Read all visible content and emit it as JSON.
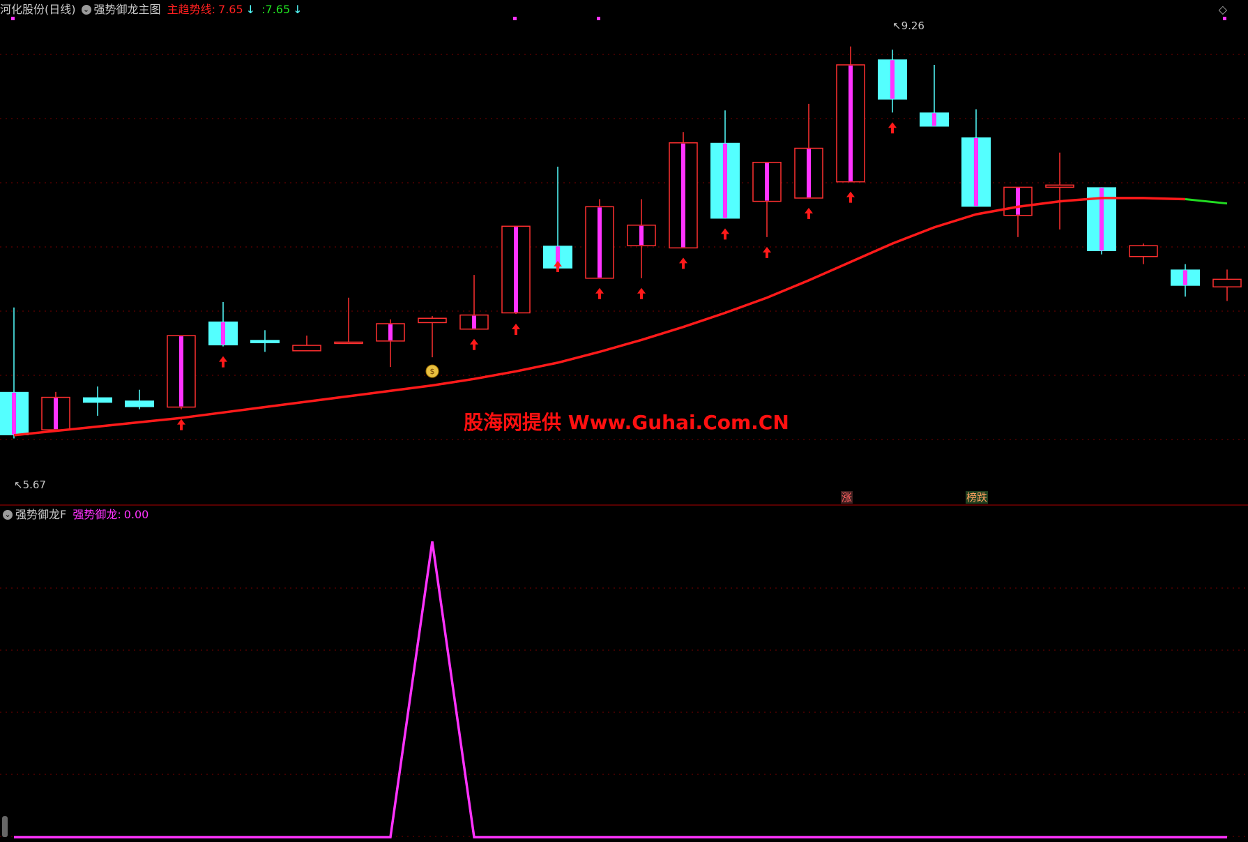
{
  "main_panel": {
    "stock_name": "河化股份(日线)",
    "indicator_name": "强势御龙主图",
    "trend_label": "主趋势线:",
    "trend_value_red": "7.65",
    "trend_value_green": ":7.65",
    "down_arrow": "↓",
    "high_label": "9.26",
    "low_label": "5.67",
    "tag_zhang": "涨",
    "tag_bangdie": "榜跌",
    "watermark": "股海网提供 Www.Guhai.Com.CN"
  },
  "sub_panel": {
    "indicator_name": "强势御龙F",
    "series_label": "强势御龙:",
    "series_value": "0.00"
  },
  "colors": {
    "up": "#ff3030",
    "down": "#54ffff",
    "trend": "#ff1a1a",
    "trend_tail": "#22dd22",
    "magenta": "#ff33ff",
    "grid": "#7a0000"
  },
  "icons": [
    "chevron-down-icon",
    "diamond-icon",
    "up-arrow-icon",
    "money-bag-icon"
  ],
  "chart_data": [
    {
      "type": "candlestick",
      "title": "强势御龙主图",
      "ylim": [
        5.3,
        9.5
      ],
      "candles": [
        {
          "o": 6.1,
          "h": 6.88,
          "l": 5.67,
          "c": 5.7
        },
        {
          "o": 5.75,
          "h": 6.1,
          "l": 5.75,
          "c": 6.05
        },
        {
          "o": 6.05,
          "h": 6.15,
          "l": 5.88,
          "c": 6.0
        },
        {
          "o": 6.02,
          "h": 6.12,
          "l": 5.94,
          "c": 5.96
        },
        {
          "o": 5.96,
          "h": 6.62,
          "l": 5.94,
          "c": 6.62
        },
        {
          "o": 6.75,
          "h": 6.93,
          "l": 6.52,
          "c": 6.53
        },
        {
          "o": 6.58,
          "h": 6.67,
          "l": 6.47,
          "c": 6.55
        },
        {
          "o": 6.48,
          "h": 6.62,
          "l": 6.48,
          "c": 6.53
        },
        {
          "o": 6.55,
          "h": 6.97,
          "l": 6.55,
          "c": 6.56
        },
        {
          "o": 6.57,
          "h": 6.77,
          "l": 6.33,
          "c": 6.73
        },
        {
          "o": 6.74,
          "h": 6.8,
          "l": 6.42,
          "c": 6.78
        },
        {
          "o": 6.68,
          "h": 7.18,
          "l": 6.68,
          "c": 6.81
        },
        {
          "o": 6.83,
          "h": 7.63,
          "l": 6.82,
          "c": 7.63
        },
        {
          "o": 7.45,
          "h": 8.18,
          "l": 7.4,
          "c": 7.24
        },
        {
          "o": 7.15,
          "h": 7.88,
          "l": 7.15,
          "c": 7.81
        },
        {
          "o": 7.45,
          "h": 7.88,
          "l": 7.15,
          "c": 7.64
        },
        {
          "o": 7.43,
          "h": 8.5,
          "l": 7.43,
          "c": 8.4
        },
        {
          "o": 8.4,
          "h": 8.7,
          "l": 7.7,
          "c": 7.7
        },
        {
          "o": 7.86,
          "h": 8.03,
          "l": 7.53,
          "c": 8.22
        },
        {
          "o": 7.89,
          "h": 8.76,
          "l": 7.89,
          "c": 8.35
        },
        {
          "o": 8.04,
          "h": 9.29,
          "l": 8.04,
          "c": 9.12
        },
        {
          "o": 9.17,
          "h": 9.26,
          "l": 8.68,
          "c": 8.8
        },
        {
          "o": 8.68,
          "h": 9.12,
          "l": 8.61,
          "c": 8.55
        },
        {
          "o": 8.45,
          "h": 8.71,
          "l": 7.84,
          "c": 7.81
        },
        {
          "o": 7.73,
          "h": 7.92,
          "l": 7.53,
          "c": 7.99
        },
        {
          "o": 7.99,
          "h": 8.31,
          "l": 7.6,
          "c": 8.01
        },
        {
          "o": 7.99,
          "h": 7.99,
          "l": 7.37,
          "c": 7.4
        },
        {
          "o": 7.35,
          "h": 7.47,
          "l": 7.28,
          "c": 7.45
        },
        {
          "o": 7.23,
          "h": 7.28,
          "l": 6.98,
          "c": 7.08
        },
        {
          "o": 7.07,
          "h": 7.23,
          "l": 6.94,
          "c": 7.14
        }
      ],
      "trend_line": [
        5.7,
        5.74,
        5.78,
        5.82,
        5.86,
        5.91,
        5.96,
        6.01,
        6.06,
        6.11,
        6.16,
        6.22,
        6.29,
        6.37,
        6.47,
        6.58,
        6.7,
        6.83,
        6.97,
        7.13,
        7.3,
        7.47,
        7.62,
        7.74,
        7.81,
        7.86,
        7.89,
        7.89,
        7.88,
        7.84
      ],
      "trend_green_from_index": 28,
      "arrows_under_index": [
        4,
        5,
        11,
        12,
        13,
        14,
        15,
        16,
        17,
        18,
        19,
        20,
        21
      ],
      "money_bag_index": 10,
      "high": 9.26,
      "low": 5.67
    },
    {
      "type": "line",
      "title": "强势御龙F",
      "series": [
        {
          "name": "强势御龙",
          "values": [
            0,
            0,
            0,
            0,
            0,
            0,
            0,
            0,
            0,
            0,
            1,
            0,
            0,
            0,
            0,
            0,
            0,
            0,
            0,
            0,
            0,
            0,
            0,
            0,
            0,
            0,
            0,
            0,
            0,
            0
          ]
        }
      ],
      "ylim": [
        0,
        1.05
      ]
    }
  ]
}
